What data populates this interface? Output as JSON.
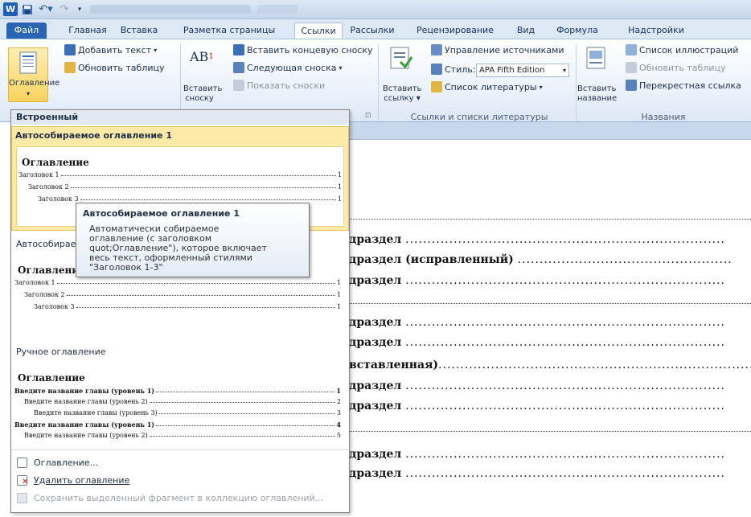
{
  "quick_access": {
    "logo": "W",
    "save_icon": "save-icon",
    "undo_icon": "undo-icon",
    "redo_icon": "redo-icon"
  },
  "tabs": [
    "Файл",
    "Главная",
    "Вставка",
    "Разметка страницы",
    "Ссылки",
    "Рассылки",
    "Рецензирование",
    "Вид",
    "Формула",
    "Надстройки"
  ],
  "ribbon": {
    "toc_button": "Оглавление",
    "add_text": "Добавить текст",
    "update_table": "Обновить таблицу",
    "insert_footnote_line1": "Вставить",
    "insert_footnote_line2": "сноску",
    "footnote_ab": "AB",
    "insert_endnote": "Вставить концевую сноску",
    "next_footnote": "Следующая сноска",
    "show_notes": "Показать сноски",
    "insert_citation_line1": "Вставить",
    "insert_citation_line2": "ссылку",
    "manage_sources": "Управление источниками",
    "style_label": "Стиль:",
    "style_value": "APA Fifth Edition",
    "bibliography": "Список литературы",
    "group_citations": "Ссылки и списки литературы",
    "insert_caption_line1": "Вставить",
    "insert_caption_line2": "название",
    "table_of_figures": "Список иллюстраций",
    "update_table2": "Обновить таблицу",
    "cross_reference": "Перекрестная ссылка",
    "group_captions": "Названия"
  },
  "gallery": {
    "builtin_header": "Встроенный",
    "auto1_title": "Автособираемое оглавление 1",
    "auto2_title": "Автособираем",
    "toc_word": "Оглавление",
    "heading1": "Заголовок 1",
    "heading2": "Заголовок 2",
    "heading3": "Заголовок 3",
    "page1": "1",
    "manual_title": "Ручное оглавление",
    "manual_l1": "Введите название главы (уровень 1)",
    "manual_l2": "Введите название главы (уровень 2)",
    "manual_l3": "Введите название главы (уровень 3)",
    "manual_p1": "1",
    "manual_p2": "2",
    "manual_p3": "3",
    "manual_p4": "4",
    "manual_p5": "5",
    "cmd_toc": "Оглавление...",
    "cmd_delete": "Удалить оглавление",
    "cmd_save": "Сохранить выделенный фрагмент в коллекцию оглавлений..."
  },
  "tooltip": {
    "title": "Автособираемое оглавление 1",
    "body": "Автоматически собираемое оглавление (с заголовком quot;Оглавление\"), которое включает весь текст, оформленный стилями \"Заголовок 1-3\""
  },
  "document": {
    "lines": [
      "драздел",
      "драздел (исправленный)",
      "драздел",
      "драздел",
      "драздел",
      "вставленная)",
      "драздел",
      "драздел",
      "драздел",
      "драздел"
    ]
  }
}
